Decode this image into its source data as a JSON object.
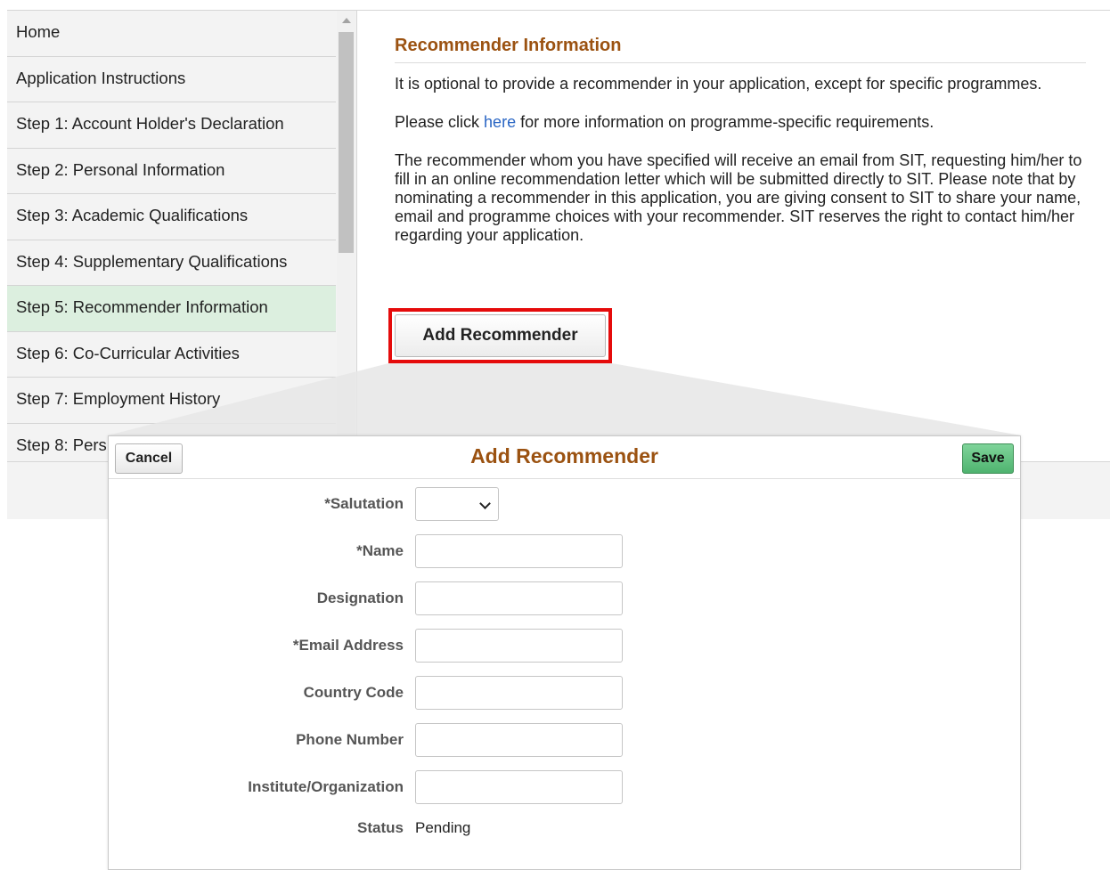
{
  "sidebar": {
    "items": [
      {
        "label": "Home"
      },
      {
        "label": "Application Instructions"
      },
      {
        "label": "Step 1: Account Holder's Declaration"
      },
      {
        "label": "Step 2: Personal Information"
      },
      {
        "label": "Step 3: Academic Qualifications"
      },
      {
        "label": "Step 4: Supplementary Qualifications"
      },
      {
        "label": "Step 5: Recommender Information",
        "active": true
      },
      {
        "label": "Step 6: Co-Curricular Activities"
      },
      {
        "label": "Step 7: Employment History"
      },
      {
        "label": "Step 8: Pers"
      }
    ]
  },
  "main": {
    "section_title": "Recommender Information",
    "para1": "It is optional to provide a recommender in your application, except for specific programmes.",
    "para2_prefix": "Please click ",
    "para2_link": "here",
    "para2_suffix": " for more information on programme-specific requirements.",
    "para3": "The recommender whom you have specified will receive an email from SIT, requesting him/her to fill in an online recommendation letter which will be submitted directly to SIT. Please note that by nominating a recommender in this application, you are giving consent to SIT to share your name, email and programme choices with your recommender. SIT reserves the right to contact him/her regarding your application.",
    "add_button_label": "Add Recommender"
  },
  "modal": {
    "title": "Add Recommender",
    "cancel_label": "Cancel",
    "save_label": "Save",
    "fields": {
      "salutation": {
        "label": "*Salutation",
        "value": ""
      },
      "name": {
        "label": "*Name",
        "value": ""
      },
      "designation": {
        "label": "Designation",
        "value": ""
      },
      "email": {
        "label": "*Email Address",
        "value": ""
      },
      "country_code": {
        "label": "Country Code",
        "value": ""
      },
      "phone": {
        "label": "Phone Number",
        "value": ""
      },
      "institute": {
        "label": "Institute/Organization",
        "value": ""
      },
      "status": {
        "label": "Status",
        "value": "Pending"
      }
    }
  },
  "colors": {
    "heading": "#9b5211",
    "link": "#2a66c4",
    "active_nav": "#dcefdf",
    "highlight": "#e50b0b",
    "save_button": "#5cbf7b"
  }
}
